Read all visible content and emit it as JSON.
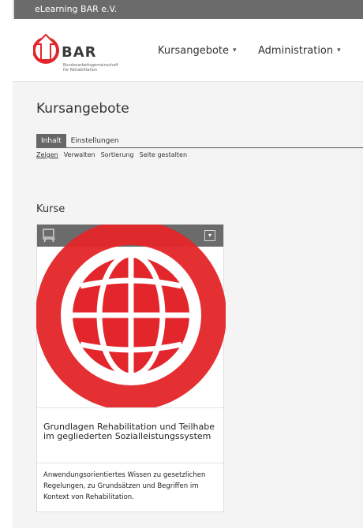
{
  "app": {
    "title": "eLearning BAR e.V."
  },
  "logo": {
    "name": "BAR",
    "subtitle_line1": "Bundesarbeitsgemeinschaft",
    "subtitle_line2": "für Rehabilitation"
  },
  "nav": {
    "items": [
      {
        "label": "Kursangebote",
        "icon": "chevron-down-icon"
      },
      {
        "label": "Administration",
        "icon": "chevron-down-icon"
      }
    ]
  },
  "page": {
    "title": "Kursangebote"
  },
  "tabs": [
    {
      "label": "Inhalt",
      "active": true
    },
    {
      "label": "Einstellungen",
      "active": false
    }
  ],
  "subnav": [
    {
      "label": "Zeigen",
      "active": true
    },
    {
      "label": "Verwalten",
      "active": false
    },
    {
      "label": "Sortierung",
      "active": false
    },
    {
      "label": "Seite gestalten",
      "active": false
    }
  ],
  "section": {
    "title": "Kurse"
  },
  "course": {
    "icon": "presentation-board-icon",
    "image": "globe-icon",
    "title": "Grundlagen Rehabilitation und Teilhabe im gegliederten Sozialleistungssystem",
    "description": "Anwendungsorientiertes Wissen zu gesetzlichen Regelungen, zu Grundsätzen und Begriffen im Kontext von Rehabilitation."
  },
  "colors": {
    "accent_red": "#e3262b",
    "header_gray": "#6b6b6b",
    "background": "#f4f4f4"
  }
}
